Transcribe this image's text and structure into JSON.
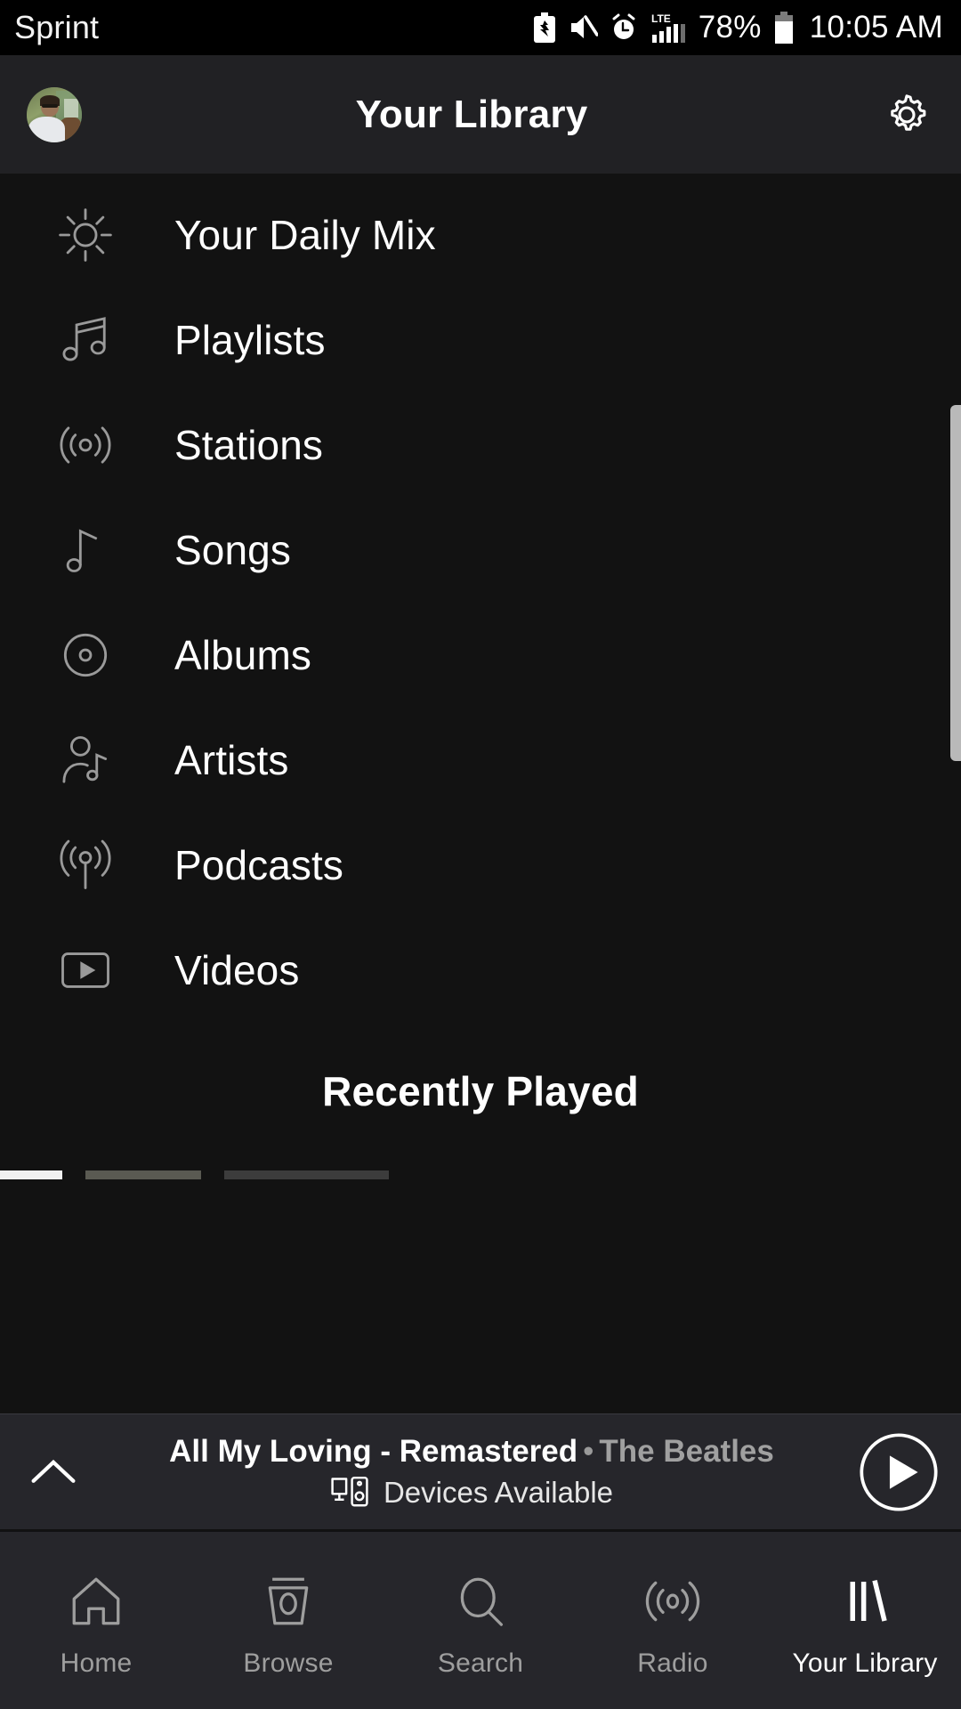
{
  "status_bar": {
    "carrier": "Sprint",
    "battery_percent": "78%",
    "time": "10:05 AM",
    "network_type": "LTE",
    "icons": [
      "battery-saver-icon",
      "mute-icon",
      "alarm-clock-icon",
      "lte-signal-icon",
      "battery-icon"
    ]
  },
  "header": {
    "title": "Your Library",
    "avatar_name": "user-avatar",
    "settings_icon": "gear-icon"
  },
  "library": {
    "items": [
      {
        "label": "Your Daily Mix",
        "icon": "sun-icon"
      },
      {
        "label": "Playlists",
        "icon": "double-music-note-icon"
      },
      {
        "label": "Stations",
        "icon": "broadcast-waves-icon"
      },
      {
        "label": "Songs",
        "icon": "music-note-icon"
      },
      {
        "label": "Albums",
        "icon": "disc-icon"
      },
      {
        "label": "Artists",
        "icon": "artist-person-note-icon"
      },
      {
        "label": "Podcasts",
        "icon": "podcast-antenna-icon"
      },
      {
        "label": "Videos",
        "icon": "video-play-icon"
      }
    ],
    "section_title": "Recently Played"
  },
  "now_playing": {
    "track_title": "All My Loving - Remastered",
    "separator": "•",
    "artist": "The Beatles",
    "devices_text": "Devices Available",
    "devices_icon": "devices-icon",
    "expand_icon": "chevron-up-icon",
    "play_icon": "play-icon"
  },
  "bottom_nav": {
    "items": [
      {
        "label": "Home",
        "icon": "home-icon",
        "active": false
      },
      {
        "label": "Browse",
        "icon": "browse-cup-icon",
        "active": false
      },
      {
        "label": "Search",
        "icon": "search-icon",
        "active": false
      },
      {
        "label": "Radio",
        "icon": "radio-waves-icon",
        "active": false
      },
      {
        "label": "Your Library",
        "icon": "library-books-icon",
        "active": true
      }
    ]
  },
  "colors": {
    "background": "#121212",
    "surface": "#26262b",
    "header_bg": "#212124",
    "text_primary": "#ffffff",
    "text_secondary": "#9e9e9e",
    "icon_outline": "#9a9a9a"
  }
}
